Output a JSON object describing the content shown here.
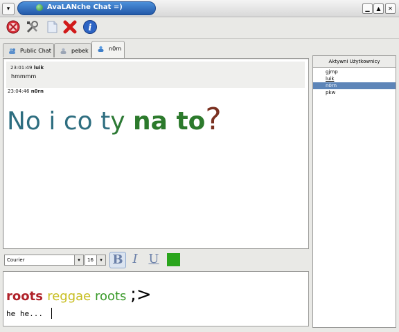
{
  "window": {
    "title": "AvaLANche Chat =)",
    "menu_glyph": "▾",
    "minimize_glyph": "▁",
    "maximize_glyph": "▲",
    "close_glyph": "✕"
  },
  "toolbar": {
    "buttons": [
      {
        "icon": "disconnect-icon"
      },
      {
        "icon": "settings-tools-icon"
      },
      {
        "icon": "document-icon"
      },
      {
        "icon": "close-x-icon"
      },
      {
        "icon": "info-icon"
      }
    ],
    "info_glyph": "i"
  },
  "tabs": [
    {
      "label": "Public Chat",
      "active": false
    },
    {
      "label": "pebek",
      "active": false
    },
    {
      "label": "n0rn",
      "active": true
    }
  ],
  "messages": [
    {
      "time": "23:01:49",
      "user": "luik",
      "text": "hmmmm"
    },
    {
      "time": "23:04:46",
      "user": "n0rn",
      "segments": [
        {
          "text": "No i co t",
          "color": "#2e6e80",
          "size": 36,
          "bold": false
        },
        {
          "text": "y ",
          "color": "#2d7a35",
          "size": 36,
          "bold": false
        },
        {
          "text": "na to",
          "color": "#2c7a2c",
          "size": 36,
          "bold": true
        },
        {
          "text": "?",
          "color": "#7a3020",
          "size": 44,
          "bold": false
        }
      ]
    }
  ],
  "users": {
    "header": "Aktywni Użytkownicy",
    "items": [
      {
        "name": "gjmp",
        "selected": false,
        "underline": false
      },
      {
        "name": "luik",
        "selected": false,
        "underline": true
      },
      {
        "name": "n0rn",
        "selected": true,
        "underline": false
      },
      {
        "name": "pkw",
        "selected": false,
        "underline": false
      }
    ]
  },
  "format": {
    "font": "Courier",
    "size": "16",
    "bold_label": "B",
    "italic_label": "I",
    "underline_label": "U",
    "color": "#2aa51c",
    "dropdown_glyph": "▾"
  },
  "input": {
    "segments": [
      {
        "text": "roots ",
        "color": "#b0222a",
        "size": 18,
        "bold": true
      },
      {
        "text": "reggae ",
        "color": "#c7bd1e",
        "size": 18,
        "bold": false
      },
      {
        "text": "roots ",
        "color": "#3a9a2a",
        "size": 18,
        "bold": false
      },
      {
        "text": ";>",
        "color": "#000000",
        "size": 26,
        "bold": false
      }
    ],
    "typed": "he he..."
  }
}
